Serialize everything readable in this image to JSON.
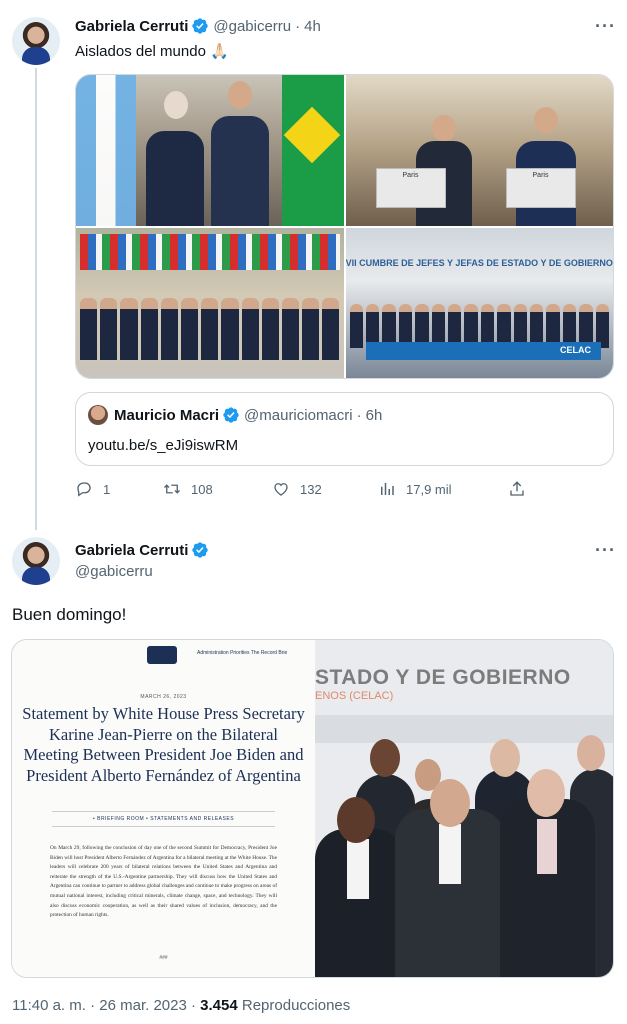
{
  "tweet1": {
    "author_name": "Gabriela Cerruti",
    "handle": "@gabicerru",
    "separator": "·",
    "time": "4h",
    "text": "Aislados del mundo 🙏🏻",
    "quote": {
      "author_name": "Mauricio Macri",
      "handle": "@mauriciomacri",
      "separator": "·",
      "time": "6h",
      "text": "youtu.be/s_eJi9iswRM"
    },
    "actions": {
      "replies": "1",
      "retweets": "108",
      "likes": "132",
      "views": "17,9 mil"
    }
  },
  "tweet2": {
    "author_name": "Gabriela Cerruti",
    "handle": "@gabicerru",
    "text": "Buen domingo!",
    "document": {
      "nav": "Administration   Priorities   The Record   Brie",
      "date": "MARCH 26, 2023",
      "title": "Statement by White House Press Secretary Karine Jean-Pierre on the Bilateral Meeting Between President Joe Biden and President Alberto Fernández of Argentina",
      "tags": "•  BRIEFING ROOM  •  STATEMENTS AND RELEASES",
      "body": "On March 29, following the conclusion of day one of the second Summit for Democracy, President Joe Biden will host President Alberto Fernández of Argentina for a bilateral meeting at the White House. The leaders will celebrate 200 years of bilateral relations between the United States and Argentina and reiterate the strength of the U.S.-Argentine partnership. They will discuss how the United States and Argentina can continue to partner to address global challenges and continue to make progress on areas of mutual national interest, including critical minerals, climate change, space, and technology. They will also discuss economic cooperation, as well as their shared values of inclusion, democracy, and the protection of human rights.",
      "end": "###"
    },
    "summit_banner": "STADO Y DE GOBIERNO",
    "summit_sub": "ENOS (CELAC)",
    "timestamp": "11:40 a. m. · 26 mar. 2023 · ",
    "views_count": "3.454",
    "views_label": " Reproducciones"
  },
  "photo_labels": {
    "podium_left": "Paris",
    "podium_right": "Paris",
    "celac_banner": "VII CUMBRE DE JEFES Y JEFAS DE ESTADO Y DE GOBIERNO",
    "celac_logo": "CELAC"
  },
  "colors": {
    "verified": "#1d9bf0",
    "text": "#0f1419",
    "secondary": "#536471",
    "border": "#cfd9de",
    "wh_navy": "#1c2f54"
  },
  "icons": [
    "more-icon",
    "verified-badge-icon",
    "reply-icon",
    "retweet-icon",
    "like-icon",
    "views-icon",
    "share-icon"
  ]
}
